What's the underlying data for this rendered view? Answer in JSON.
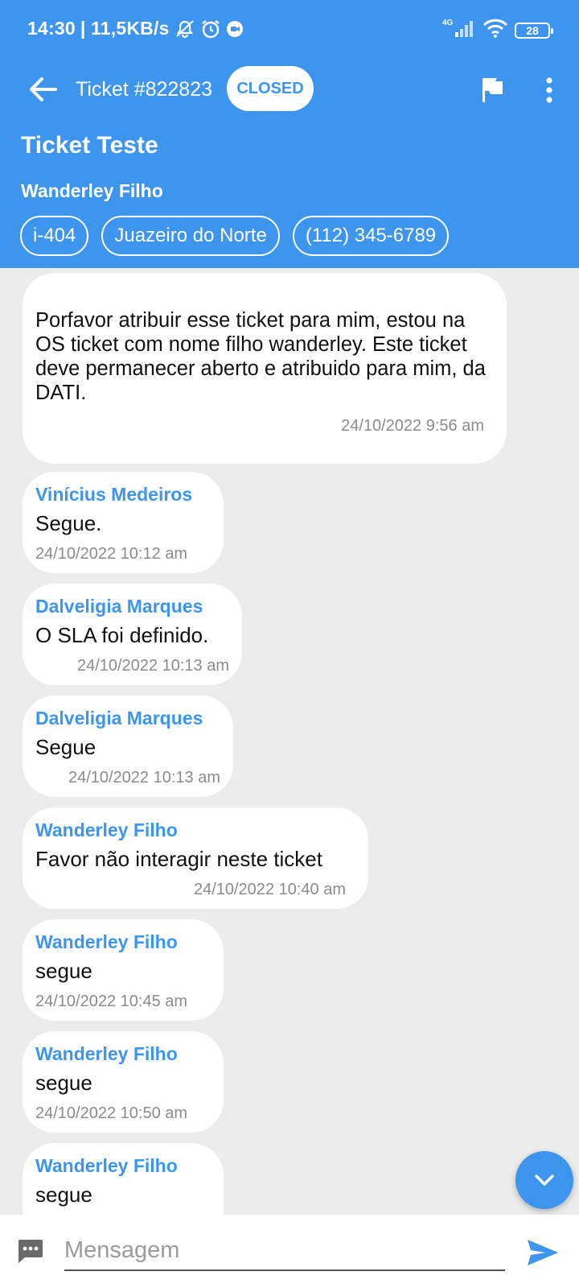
{
  "status_bar": {
    "time": "14:30",
    "speed": "| 11,5KB/s",
    "network": "4G",
    "battery": "28",
    "icons": [
      "mute-icon",
      "alarm-icon",
      "app-notification-icon",
      "signal-icon",
      "wifi-icon",
      "battery-icon"
    ]
  },
  "header": {
    "ticket_number": "Ticket #822823",
    "status_badge": "CLOSED",
    "title": "Ticket Teste",
    "requester": "Wanderley Filho",
    "chips": [
      "i-404",
      "Juazeiro do Norte",
      "(112) 345-6789"
    ],
    "icons": [
      "back-arrow-icon",
      "flag-icon",
      "more-vert-icon"
    ]
  },
  "messages": [
    {
      "author": "",
      "text": "Porfavor atribuir esse ticket para mim, estou na OS ticket com nome filho wanderley. Este ticket deve permanecer aberto e atribuido para mim, da DATI.",
      "time": "24/10/2022 9:56 am"
    },
    {
      "author": "Vinícius Medeiros",
      "text": "Segue.",
      "time": "24/10/2022 10:12 am"
    },
    {
      "author": "Dalveligia Marques",
      "text": "O SLA foi definido.",
      "time": "24/10/2022 10:13 am"
    },
    {
      "author": "Dalveligia Marques",
      "text": "Segue",
      "time": "24/10/2022 10:13 am"
    },
    {
      "author": "Wanderley Filho",
      "text": "Favor não interagir neste ticket",
      "time": "24/10/2022 10:40 am"
    },
    {
      "author": "Wanderley Filho",
      "text": "segue",
      "time": "24/10/2022 10:45 am"
    },
    {
      "author": "Wanderley Filho",
      "text": "segue",
      "time": "24/10/2022 10:50 am"
    },
    {
      "author": "Wanderley Filho",
      "text": "segue",
      "time": ""
    }
  ],
  "composer": {
    "placeholder": "Mensagem",
    "icons": [
      "emoji-icon",
      "send-icon",
      "scroll-down-icon"
    ]
  },
  "colors": {
    "primary": "#3d95ee",
    "background": "#ececec",
    "bubble": "#ffffff",
    "timestamp": "#8c8c8c"
  }
}
